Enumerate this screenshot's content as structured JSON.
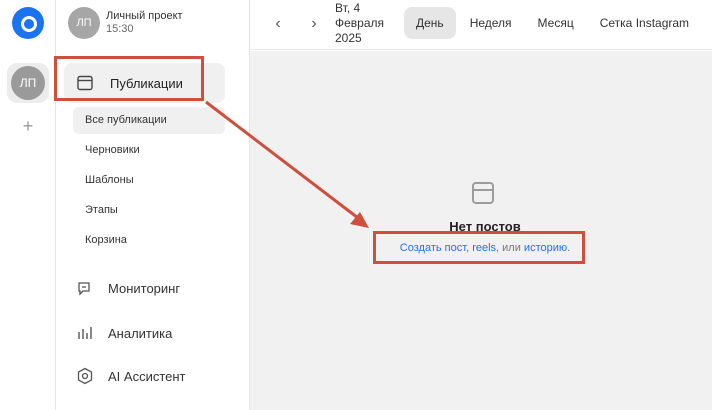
{
  "rail": {
    "avatar_initials": "ЛП",
    "add_label": "+"
  },
  "project": {
    "initials": "ЛП",
    "name": "Личный проект",
    "time": "15:30"
  },
  "sidebar": {
    "publications_label": "Публикации",
    "sub_items": [
      {
        "label": "Все публикации",
        "active": true
      },
      {
        "label": "Черновики",
        "active": false
      },
      {
        "label": "Шаблоны",
        "active": false
      },
      {
        "label": "Этапы",
        "active": false
      },
      {
        "label": "Корзина",
        "active": false
      }
    ],
    "monitoring_label": "Мониторинг",
    "analytics_label": "Аналитика",
    "assistant_label": "AI Ассистент"
  },
  "topbar": {
    "prev_label": "‹",
    "next_label": "›",
    "date_line1": "Вт, 4",
    "date_line2": "Февраля",
    "date_line3": "2025",
    "tabs": [
      {
        "label": "День",
        "active": true
      },
      {
        "label": "Неделя",
        "active": false
      },
      {
        "label": "Месяц",
        "active": false
      },
      {
        "label": "Сетка Instagram",
        "active": false
      }
    ]
  },
  "empty": {
    "title": "Нет постов",
    "create_post": "Создать пост",
    "sep1": ", ",
    "reels": "reels",
    "sep2": ", или ",
    "story": "историю",
    "end": "."
  },
  "colors": {
    "accent": "#1b73f0",
    "annotation": "#cf4e3c"
  }
}
